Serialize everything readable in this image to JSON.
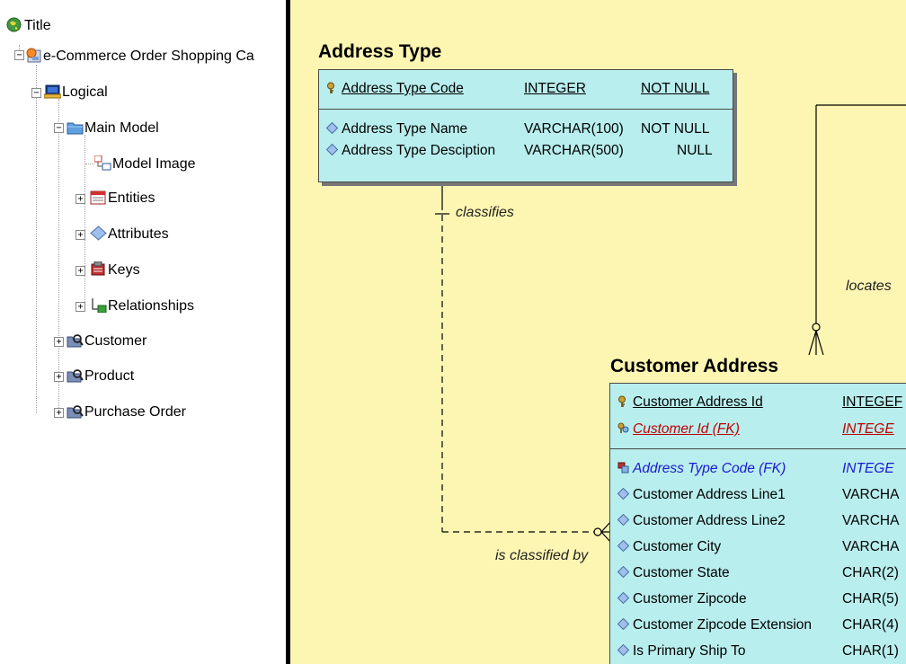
{
  "tree": {
    "root": "Title",
    "model": "e-Commerce Order Shopping Ca",
    "logical": "Logical",
    "main_model": "Main Model",
    "model_image": "Model Image",
    "entities": "Entities",
    "attributes": "Attributes",
    "keys": "Keys",
    "relationships": "Relationships",
    "customer": "Customer",
    "product": "Product",
    "purchase_order": "Purchase Order"
  },
  "diagram": {
    "address_type": {
      "title": "Address Type",
      "pk": [
        {
          "name": "Address Type Code",
          "type": "INTEGER",
          "null": "NOT NULL"
        }
      ],
      "attrs": [
        {
          "name": "Address Type Name",
          "type": "VARCHAR(100)",
          "null": "NOT NULL"
        },
        {
          "name": "Address Type Desciption",
          "type": "VARCHAR(500)",
          "null": "NULL"
        }
      ]
    },
    "customer_address": {
      "title": "Customer Address",
      "pk": [
        {
          "name": "Customer Address Id",
          "type": "INTEGEF"
        },
        {
          "name": "Customer Id (FK)",
          "type": "INTEGE"
        }
      ],
      "attrs": [
        {
          "name": "Address Type Code (FK)",
          "type": "INTEGE"
        },
        {
          "name": "Customer Address Line1",
          "type": "VARCHA"
        },
        {
          "name": "Customer Address Line2",
          "type": "VARCHA"
        },
        {
          "name": "Customer City",
          "type": "VARCHA"
        },
        {
          "name": "Customer State",
          "type": "CHAR(2)"
        },
        {
          "name": "Customer Zipcode",
          "type": "CHAR(5)"
        },
        {
          "name": "Customer Zipcode Extension",
          "type": "CHAR(4)"
        },
        {
          "name": "Is Primary Ship To",
          "type": "CHAR(1)"
        }
      ]
    },
    "rel_classifies": "classifies",
    "rel_is_classified_by": "is classified by",
    "rel_locates": "locates"
  }
}
